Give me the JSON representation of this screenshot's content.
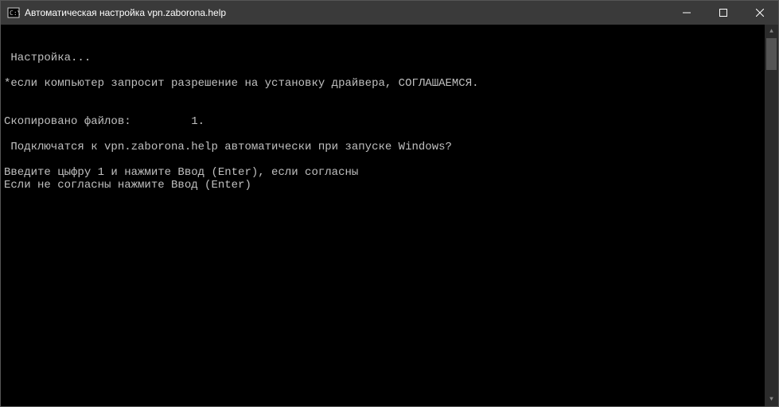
{
  "window": {
    "title": "Автоматическая настройка vpn.zaborona.help"
  },
  "console": {
    "lines": [
      "",
      "",
      " Настройка...",
      "",
      "*если компьютер запросит разрешение на установку драйвера, СОГЛАШАЕМСЯ.",
      "",
      "",
      "Скопировано файлов:         1.",
      "",
      " Подключатся к vpn.zaborona.help автоматически при запуске Windows?",
      "",
      "Введите цыфру 1 и нажмите Ввод (Enter), если согласны",
      "Если не согласны нажмите Ввод (Enter)"
    ]
  }
}
